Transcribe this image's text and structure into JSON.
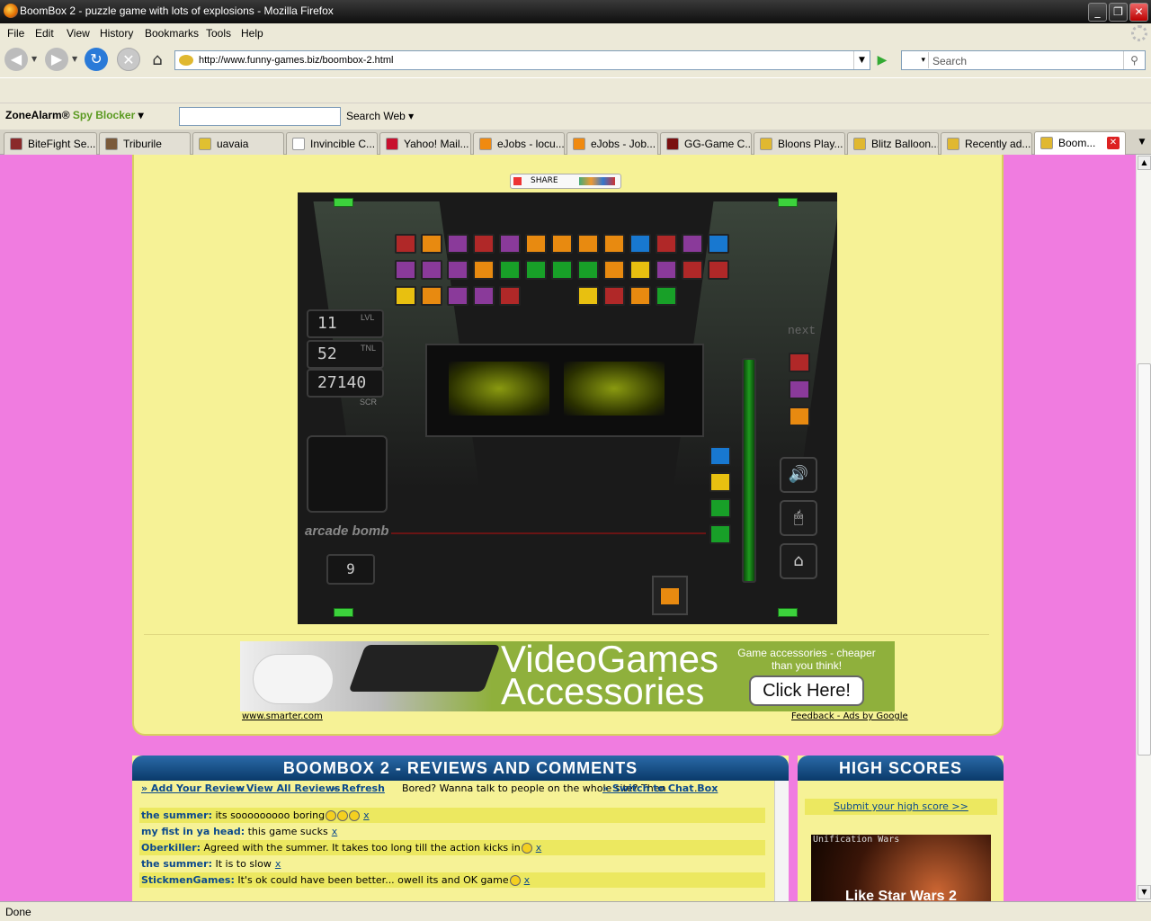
{
  "window": {
    "title": "BoomBox 2 - puzzle game with lots of explosions - Mozilla Firefox"
  },
  "menu": [
    "File",
    "Edit",
    "View",
    "History",
    "Bookmarks",
    "Tools",
    "Help"
  ],
  "nav": {
    "url": "http://www.funny-games.biz/boombox-2.html",
    "search_placeholder": "Search"
  },
  "zonealarm": {
    "brand": "ZoneAlarm",
    "product": "Spy Blocker",
    "search_label": "Search Web"
  },
  "tabs": [
    {
      "label": "BiteFight Se...",
      "color": "#8a2a2a"
    },
    {
      "label": "Triburile",
      "color": "#7a5a3a"
    },
    {
      "label": "uavaia",
      "color": "#e0c030"
    },
    {
      "label": "Invincible C...",
      "color": "#ffffff"
    },
    {
      "label": "Yahoo! Mail...",
      "color": "#c8102e"
    },
    {
      "label": "eJobs - locu...",
      "color": "#f08a10"
    },
    {
      "label": "eJobs - Job...",
      "color": "#f08a10"
    },
    {
      "label": "GG-Game C...",
      "color": "#7a1010"
    },
    {
      "label": "Bloons Play...",
      "color": "#e0b830"
    },
    {
      "label": "Blitz Balloon...",
      "color": "#e0b830"
    },
    {
      "label": "Recently ad...",
      "color": "#e0b830"
    },
    {
      "label": "Boom...",
      "color": "#e0b830"
    }
  ],
  "share": {
    "label": "SHARE"
  },
  "game": {
    "level": "11",
    "level_label": "LVL",
    "tnl": "52",
    "tnl_label": "TNL",
    "score": "27140",
    "score_label": "SCR",
    "next_label": "next",
    "counter": "9",
    "brand": "arcade bomb"
  },
  "ad": {
    "headline1": "VideoGames",
    "headline2": "Accessories",
    "tagline": "Game accessories - cheaper than you think!",
    "cta": "Click Here!",
    "source": "www.smarter.com",
    "feedback": "Feedback - Ads by Google"
  },
  "reviews": {
    "title": "BOOMBOX 2 - REVIEWS AND COMMENTS",
    "add": "» Add Your Review",
    "view_all": "» View All Reviews",
    "refresh": "» Refresh",
    "chat_text": "Bored? Wanna talk to people on the whole site? Then",
    "chat_link": "» Switch to Chat Box",
    "items": [
      {
        "name": "the summer:",
        "text": "its sooooooooo boring",
        "smileys": 3
      },
      {
        "name": "my fist in ya head:",
        "text": "this game sucks",
        "smileys": 0
      },
      {
        "name": "Oberkiller:",
        "text": "Agreed with the summer. It takes too long till the action kicks in",
        "smileys": 1
      },
      {
        "name": "the summer:",
        "text": "It is to slow",
        "smileys": 0
      },
      {
        "name": "StickmenGames:",
        "text": "It's ok could have been better... owell its and OK game",
        "smileys": 1
      }
    ],
    "delete_mark": "x"
  },
  "highscores": {
    "title": "HIGH SCORES",
    "submit": "Submit your high score >>",
    "thumb_title": "Unification Wars",
    "thumb_text": "Like Star Wars 2"
  },
  "status": "Done"
}
